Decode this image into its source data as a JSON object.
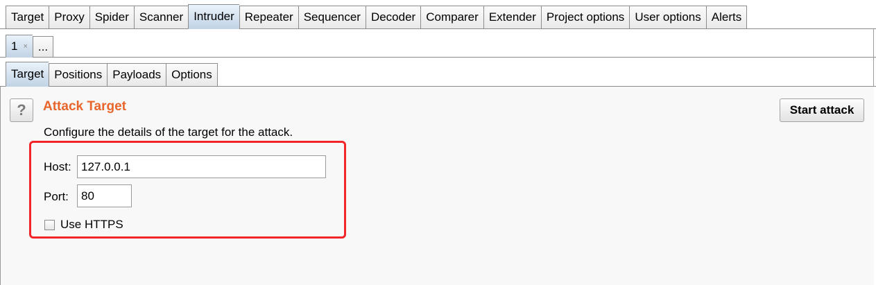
{
  "top_tabs": [
    {
      "label": "Target"
    },
    {
      "label": "Proxy"
    },
    {
      "label": "Spider"
    },
    {
      "label": "Scanner"
    },
    {
      "label": "Intruder",
      "active": true
    },
    {
      "label": "Repeater"
    },
    {
      "label": "Sequencer"
    },
    {
      "label": "Decoder"
    },
    {
      "label": "Comparer"
    },
    {
      "label": "Extender"
    },
    {
      "label": "Project options"
    },
    {
      "label": "User options"
    },
    {
      "label": "Alerts"
    }
  ],
  "attack_tabs": [
    {
      "label": "1",
      "close": "×",
      "active": true
    },
    {
      "label": "..."
    }
  ],
  "inner_tabs": [
    {
      "label": "Target",
      "active": true
    },
    {
      "label": "Positions"
    },
    {
      "label": "Payloads"
    },
    {
      "label": "Options"
    }
  ],
  "panel": {
    "help_glyph": "?",
    "title": "Attack Target",
    "description": "Configure the details of the target for the attack.",
    "start_button": "Start attack",
    "host_label": "Host:",
    "host_value": "127.0.0.1",
    "port_label": "Port:",
    "port_value": "80",
    "https_label": "Use HTTPS",
    "https_checked": false
  },
  "colors": {
    "title": "#e8652c",
    "highlight_border": "#f2252b",
    "active_tab": "#c2d4e6"
  }
}
